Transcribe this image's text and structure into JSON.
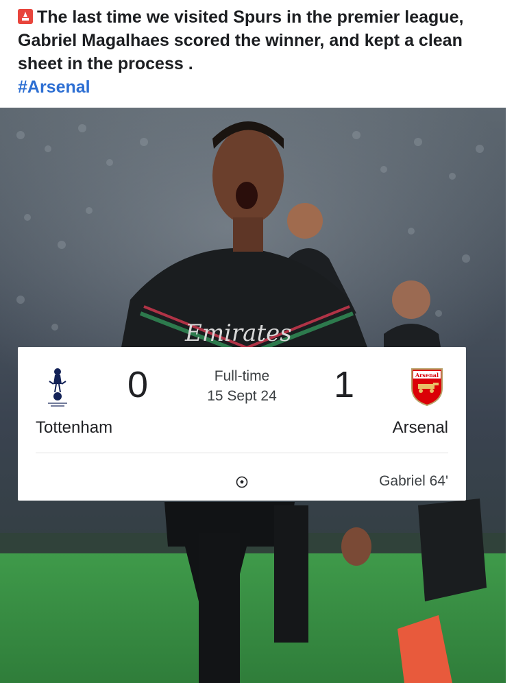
{
  "post": {
    "icon": "siren-alert-icon",
    "text": "The last time we visited Spurs in the premier league, Gabriel Magalhaes scored the winner, and kept a clean sheet in the process .",
    "hashtag": "#Arsenal"
  },
  "photo": {
    "shirt_sponsor": "Emirates"
  },
  "match": {
    "home_team": "Tottenham",
    "home_score": "0",
    "away_team": "Arsenal",
    "away_score": "1",
    "status": "Full-time",
    "date": "15 Sept 24",
    "away_badge_text": "Arsenal",
    "scorer": "Gabriel 64'"
  },
  "colors": {
    "hashtag": "#2d6fd3",
    "arsenal_red": "#db0007",
    "spurs_navy": "#132257"
  }
}
